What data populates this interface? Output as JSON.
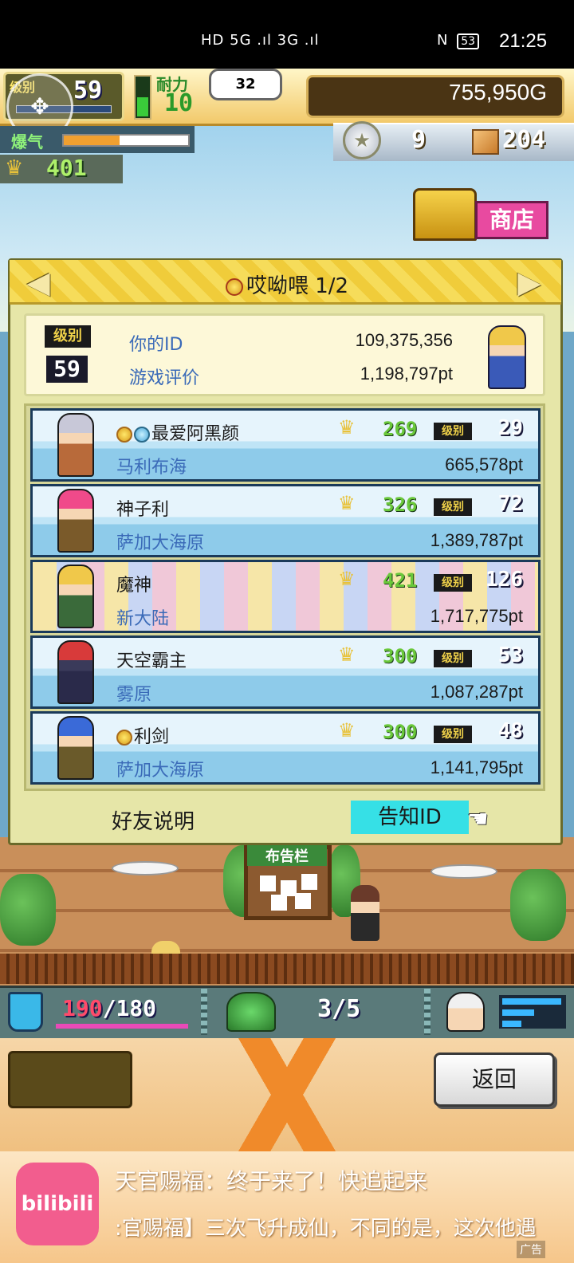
{
  "status_bar": {
    "network": "HD 5G .ıl 3G .ıl",
    "nfc": "N",
    "battery": "53",
    "time": "21:25"
  },
  "hud": {
    "level_label": "级别",
    "level": "59",
    "stamina_label": "耐力",
    "stamina": "10",
    "bubble": "32",
    "gold": "755,950G",
    "burst_label": "爆气",
    "medals": "9",
    "crates": "204",
    "eagles": "401",
    "shop_label": "商店"
  },
  "panel": {
    "title": "哎呦喂 1/2",
    "my_level_label": "级别",
    "my_level": "59",
    "my_id_label": "你的ID",
    "my_id": "109,375,356",
    "my_rating_label": "游戏评价",
    "my_rating": "1,198,797pt",
    "level_tag": "级别",
    "friends": [
      {
        "name": "最爱阿黑颜",
        "area": "马利布海",
        "points": "665,578pt",
        "eagles": "269",
        "level": "29",
        "style": "blue",
        "avatar_colors": [
          "#c8c8d8",
          "#f6d6b4",
          "#b86a3a"
        ]
      },
      {
        "name": "神子利",
        "area": "萨加大海原",
        "points": "1,389,787pt",
        "eagles": "326",
        "level": "72",
        "style": "blue",
        "avatar_colors": [
          "#f04a8a",
          "#f6d6b4",
          "#7a5a2a"
        ]
      },
      {
        "name": "魔神",
        "area": "新大陆",
        "points": "1,717,775pt",
        "eagles": "421",
        "level": "126",
        "style": "party",
        "avatar_colors": [
          "#f0c84a",
          "#f6d6b4",
          "#3a6a3a"
        ]
      },
      {
        "name": "天空霸主",
        "area": "雾原",
        "points": "1,087,287pt",
        "eagles": "300",
        "level": "53",
        "style": "blue",
        "avatar_colors": [
          "#d83a3a",
          "#3a3a5a",
          "#2a2a4a"
        ]
      },
      {
        "name": "利剑",
        "area": "萨加大海原",
        "points": "1,141,795pt",
        "eagles": "300",
        "level": "48",
        "style": "blue",
        "avatar_colors": [
          "#3a6ad8",
          "#f6d6b4",
          "#6a5a2a"
        ]
      }
    ],
    "friend_help": "好友说明",
    "notify_id": "告知ID"
  },
  "scene": {
    "board_title": "布告栏"
  },
  "bottom_hud": {
    "capacity_used": "190",
    "capacity_sep": "/",
    "capacity_max": "180",
    "slots": "3/5",
    "back_label": "返回"
  },
  "ad": {
    "logo": "bilibili",
    "title": "天官赐福：终于来了！快追起来",
    "subtitle": ":官赐福】三次飞升成仙，不同的是，这次他遇",
    "tag": "广告"
  },
  "colors": {
    "notify_button": "#36e0e6",
    "panel_bg": "#e6e6a8",
    "header_gold": "#f6dc5a",
    "name_blue": "#3a6ab8"
  },
  "icons": [
    "gamepad-icon",
    "medal-icon",
    "crate-icon",
    "eagle-icon",
    "chest-icon",
    "hand-pointer-icon",
    "bucket-icon",
    "plant-icon",
    "staff-icon"
  ]
}
